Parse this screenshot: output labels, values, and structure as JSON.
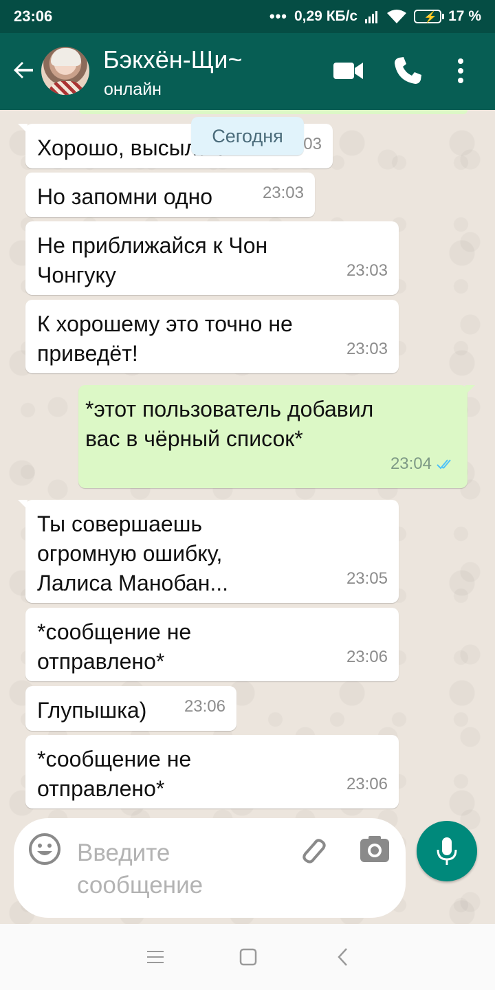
{
  "status_bar": {
    "time": "23:06",
    "network_speed": "0,29 КБ/с",
    "battery": "17 %",
    "dots": "•••"
  },
  "header": {
    "contact_name": "Бэкхён-Щи~",
    "contact_status": "онлайн",
    "icons": [
      "back-arrow-icon",
      "avatar",
      "video-call-icon",
      "phone-icon",
      "more-vert-icon"
    ]
  },
  "date_chip": "Сегодня",
  "messages": [
    {
      "dir": "in",
      "text": "Хорошо, высылаю",
      "time": "23:03"
    },
    {
      "dir": "in",
      "text": "Но запомни одно",
      "time": "23:03"
    },
    {
      "dir": "in",
      "text": "Не приближайся к Чон Чонгуку",
      "time": "23:03"
    },
    {
      "dir": "in",
      "text": "К хорошему это точно не приведёт!",
      "time": "23:03"
    },
    {
      "dir": "out",
      "text": "*этот пользователь добавил вас в чёрный список*",
      "time": "23:04",
      "read": true
    },
    {
      "dir": "in",
      "text": "Ты совершаешь огромную ошибку, Лалиса Манобан...",
      "time": "23:05"
    },
    {
      "dir": "in",
      "text": "*сообщение не отправлено*",
      "time": "23:06"
    },
    {
      "dir": "in",
      "text": "Глупышка)",
      "time": "23:06"
    },
    {
      "dir": "in",
      "text": "*сообщение не отправлено*",
      "time": "23:06"
    }
  ],
  "input": {
    "placeholder": "Введите сообщение",
    "icons": [
      "emoji-icon",
      "attach-icon",
      "camera-icon",
      "mic-icon"
    ]
  },
  "colors": {
    "header": "#075e54",
    "status_bar": "#054d44",
    "outgoing_bubble": "#dcf8c6",
    "incoming_bubble": "#ffffff",
    "chat_bg": "#ece5dd",
    "accent": "#00897b",
    "read_ticks": "#4fc3f7"
  }
}
